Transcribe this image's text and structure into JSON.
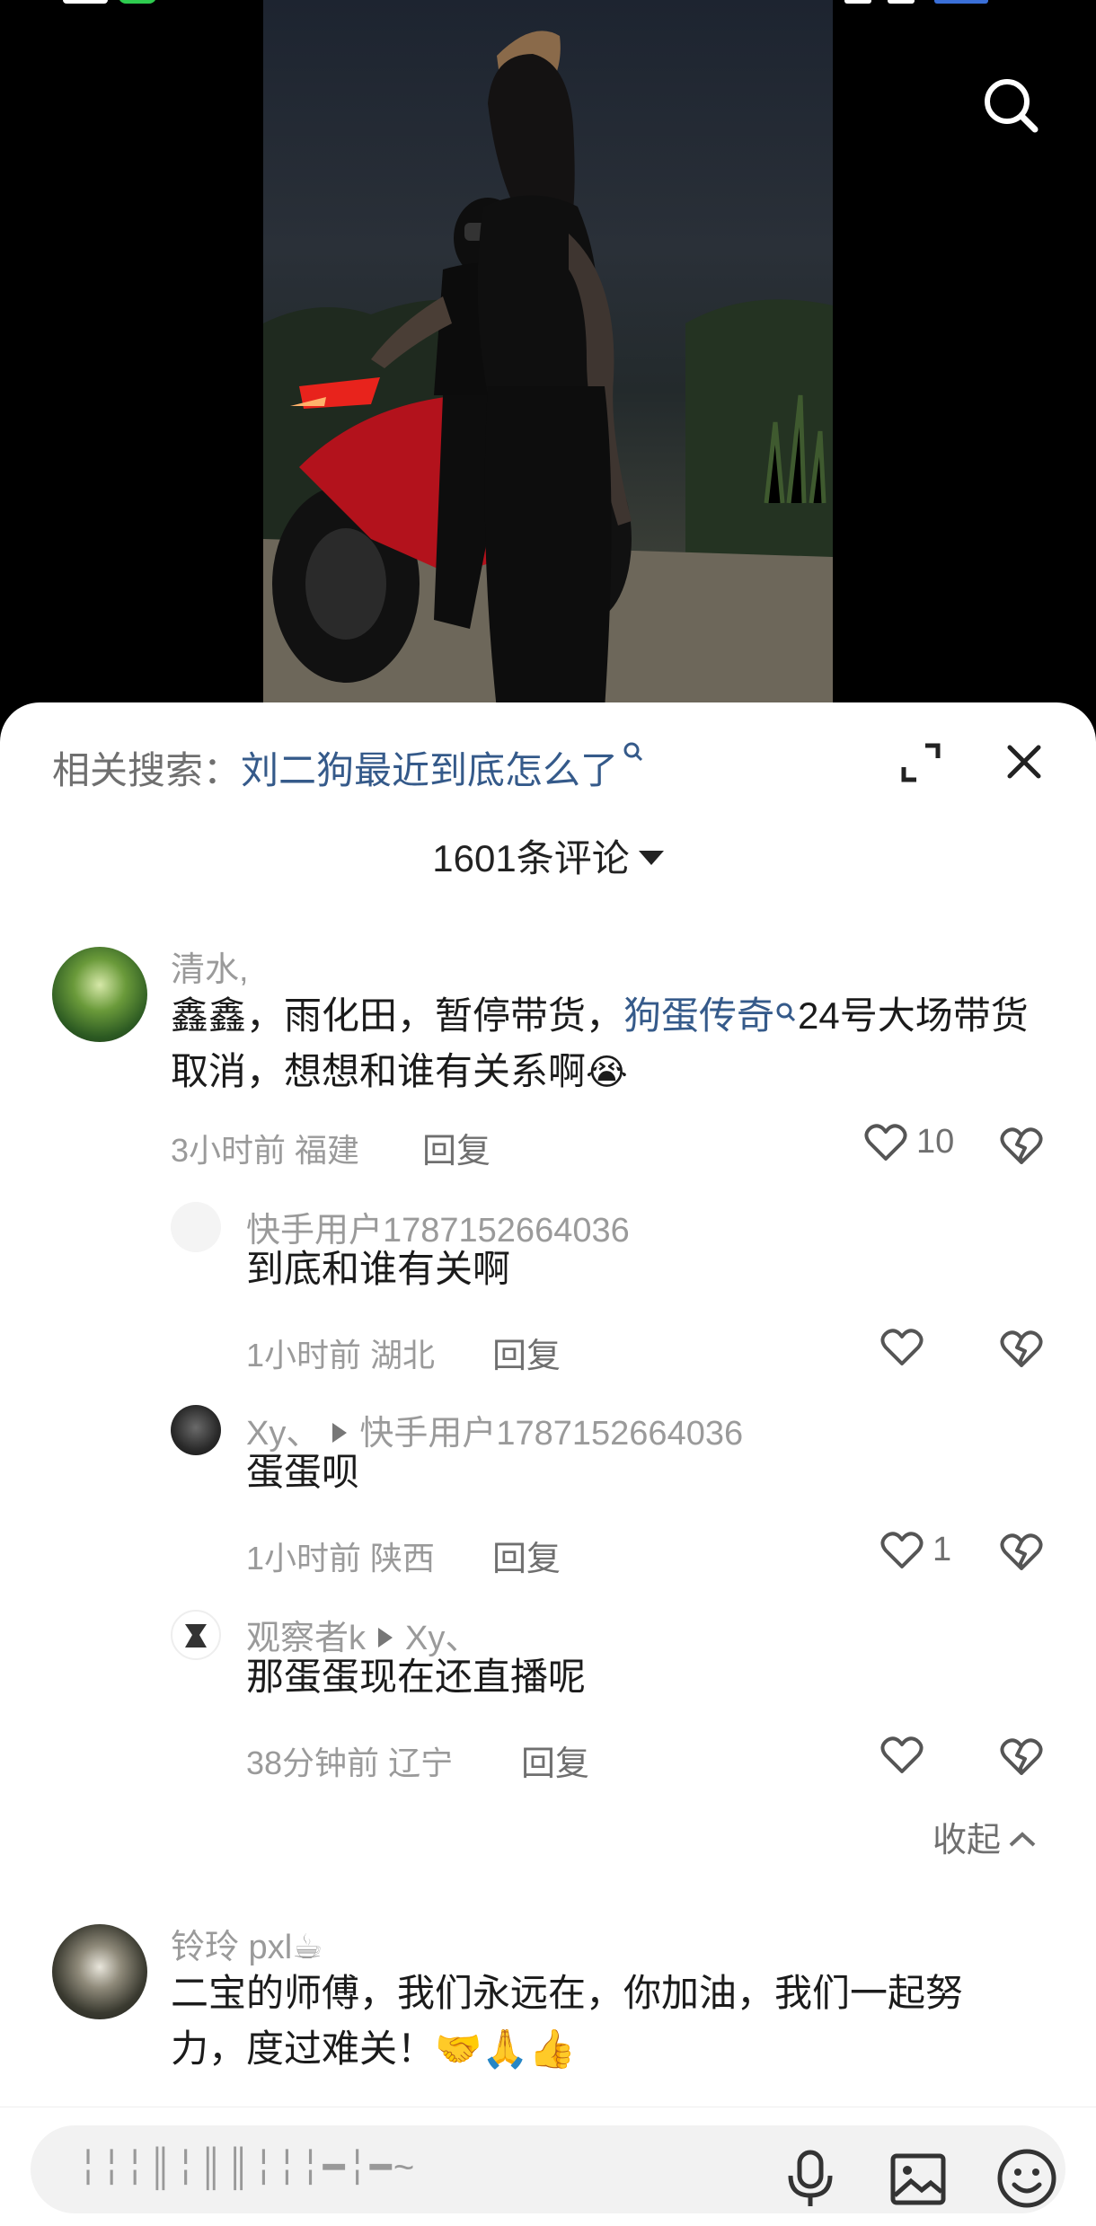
{
  "video": {
    "search_icon": "search-icon"
  },
  "sheet": {
    "related_label": "相关搜索：",
    "related_term": "刘二狗最近到底怎么了",
    "expand_icon": "expand-icon",
    "close_icon": "close-icon",
    "comment_count": "1601条评论",
    "collapse_label": "收起"
  },
  "comments": [
    {
      "user": "清水,",
      "text_a": "鑫鑫，雨化田，暂停带货，",
      "text_link": "狗蛋传奇",
      "text_b": "24号大场带货取消，想想和谁有关系啊",
      "emoji": "😭",
      "time": "3小时前",
      "location": "福建",
      "reply": "回复",
      "likes": "10"
    },
    {
      "user": "快手用户1787152664036",
      "text": "到底和谁有关啊",
      "time": "1小时前",
      "location": "湖北",
      "reply": "回复",
      "likes": ""
    },
    {
      "user": "Xy、",
      "reply_to": "快手用户1787152664036",
      "text": "蛋蛋呗",
      "time": "1小时前",
      "location": "陕西",
      "reply": "回复",
      "likes": "1"
    },
    {
      "user": "观察者k",
      "reply_to": "Xy、",
      "text": "那蛋蛋现在还直播呢",
      "time": "38分钟前",
      "location": "辽宁",
      "reply": "回复",
      "likes": ""
    },
    {
      "user": "铃玲 pxl☕",
      "text_line1": "二宝的师傅，我们永远在，你加油，我们一起努",
      "text_line2": "力，度过难关！🤝🙏👍"
    }
  ],
  "input": {
    "placeholder": "╎╎╎║╎║║╎╎╎━╎━~"
  },
  "colors": {
    "link": "#355a8a",
    "muted": "#9a9a9a",
    "sheet_bg": "#ffffff",
    "video_bg": "#000000"
  }
}
